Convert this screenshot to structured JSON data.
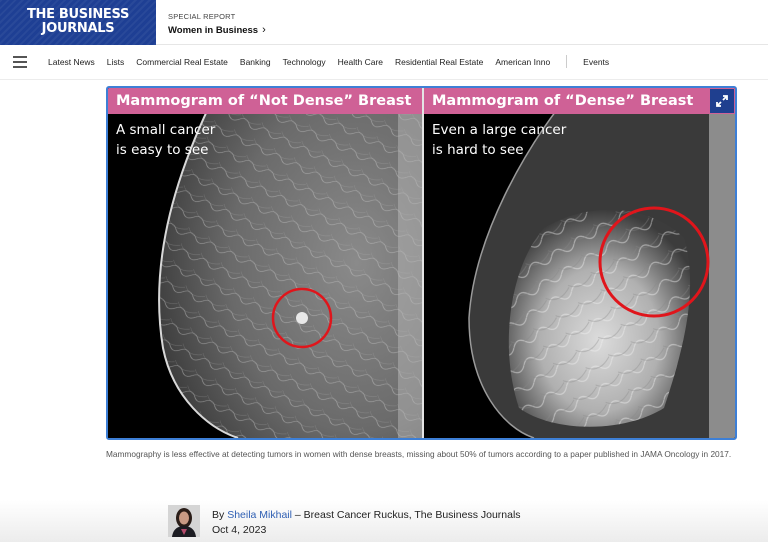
{
  "header": {
    "logo_line1": "THE BUSINESS",
    "logo_line2": "JOURNALS",
    "special_kicker": "SPECIAL REPORT",
    "special_title": "Women in Business",
    "special_chevron": "›"
  },
  "nav": {
    "menu_icon": "hamburger-icon",
    "items": [
      "Latest News",
      "Lists",
      "Commercial Real Estate",
      "Banking",
      "Technology",
      "Health Care",
      "Residential Real Estate",
      "American Inno"
    ],
    "after_separator": "Events"
  },
  "figure": {
    "left": {
      "banner": "Mammogram of “Not Dense” Breast",
      "line1": "A small cancer",
      "line2": "is easy to see"
    },
    "right": {
      "banner": "Mammogram of “Dense” Breast",
      "line1": "Even a large cancer",
      "line2": "is hard to see"
    },
    "expand_icon": "expand-icon",
    "accent_color": "#cf6196",
    "circle_color": "#e0151b"
  },
  "caption": "Mammography is less effective at detecting tumors in women with dense breasts, missing about 50% of tumors according to a paper published in JAMA Oncology in 2017.",
  "byline": {
    "prefix": "By",
    "author": "Sheila Mikhail",
    "suffix": "– Breast Cancer Ruckus, The Business Journals",
    "date": "Oct 4, 2023"
  }
}
